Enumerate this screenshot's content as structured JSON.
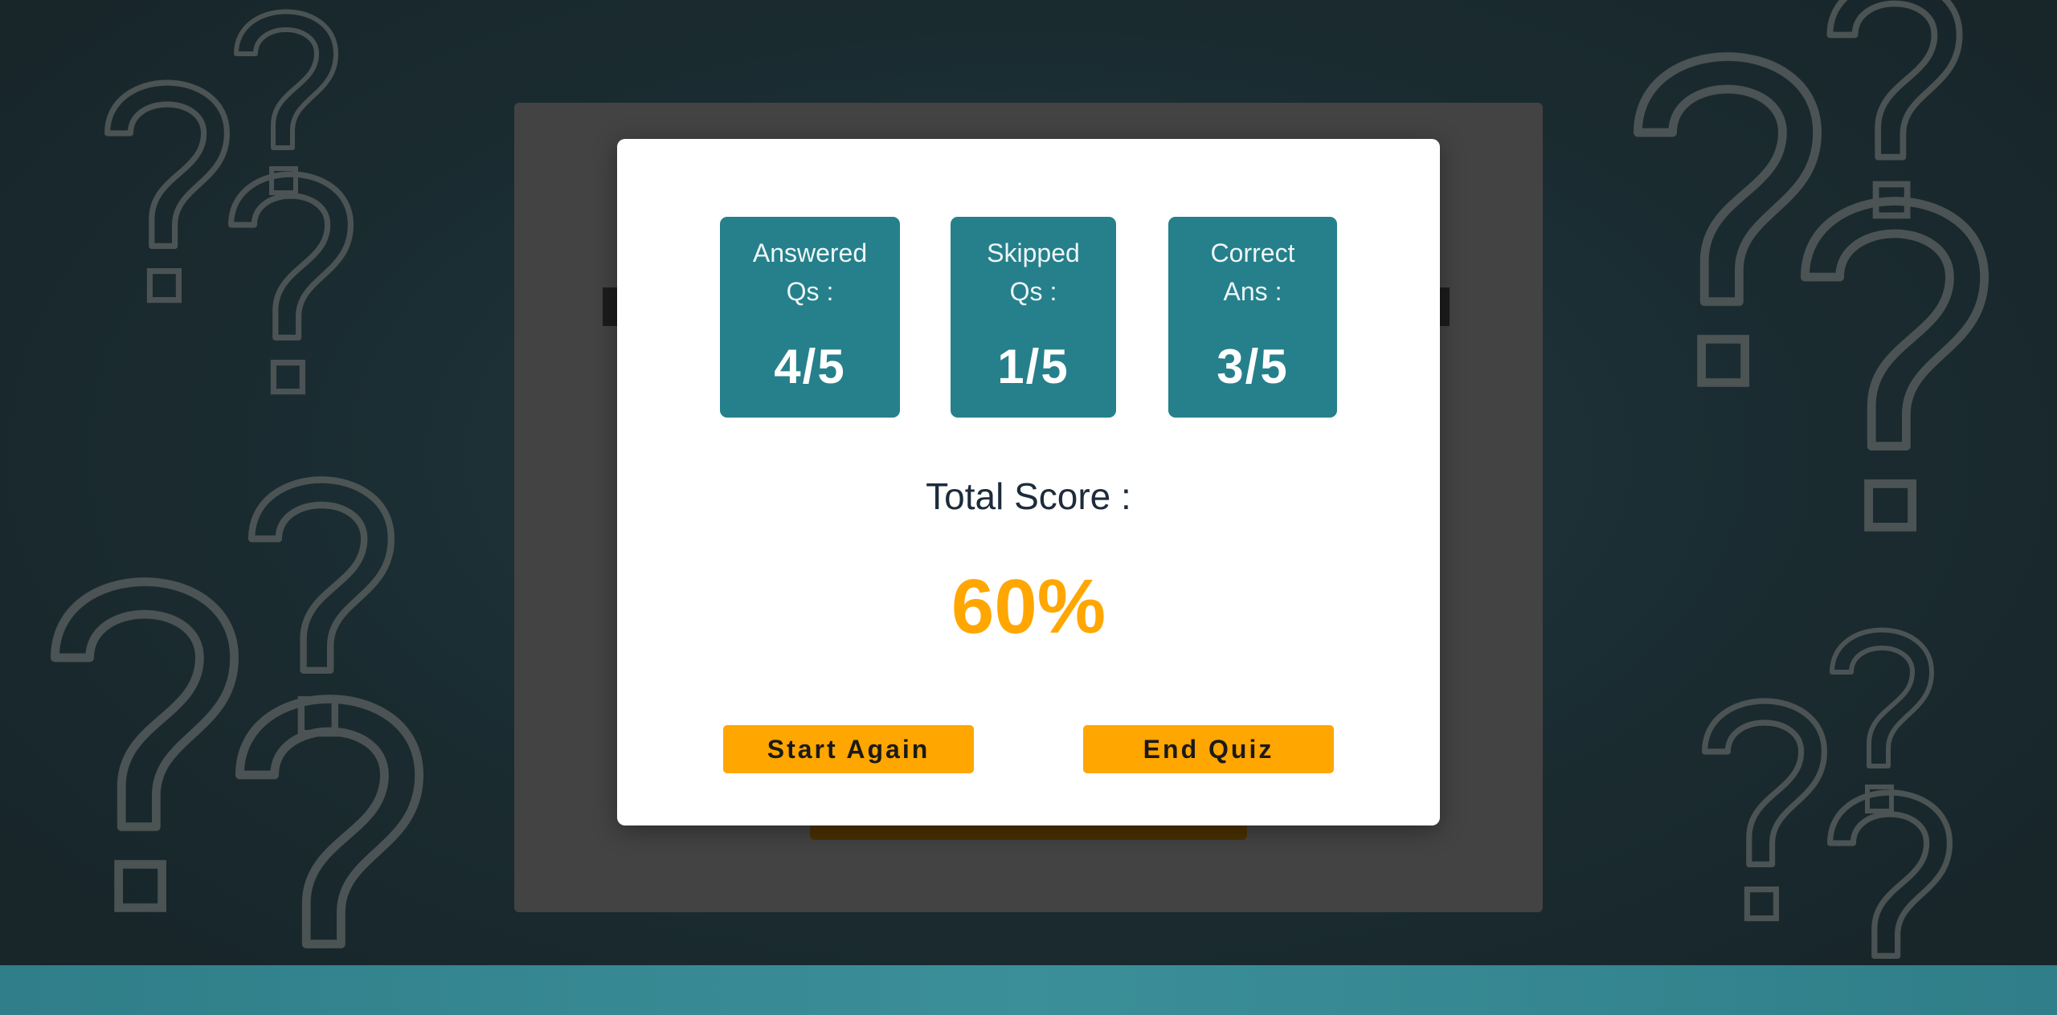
{
  "background": {
    "decoration": "question-mark-icon",
    "colors": {
      "backdrop": "#1a2b30",
      "mark_stroke": "#555555",
      "bottom_bar": "#3b8f98"
    }
  },
  "modal": {
    "stats": [
      {
        "label_line1": "Answered",
        "label_line2": "Qs :",
        "value": "4/5"
      },
      {
        "label_line1": "Skipped",
        "label_line2": "Qs :",
        "value": "1/5"
      },
      {
        "label_line1": "Correct",
        "label_line2": "Ans :",
        "value": "3/5"
      }
    ],
    "total_score_label": "Total Score :",
    "total_score_value": "60%",
    "buttons": {
      "start_again": "Start Again",
      "end_quiz": "End Quiz"
    }
  },
  "colors": {
    "accent": "#ffa600",
    "stat_box": "#25808b",
    "heading_text": "#1d2b3c"
  }
}
